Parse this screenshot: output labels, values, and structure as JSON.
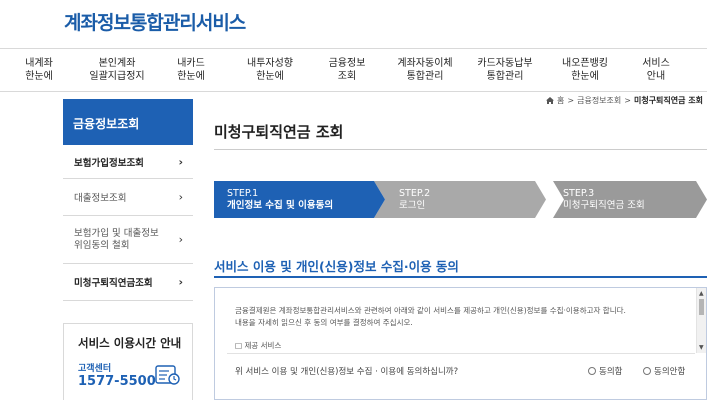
{
  "site_title": "계좌정보통합관리서비스",
  "gnb": [
    {
      "line1": "내계좌",
      "line2": "한눈에"
    },
    {
      "line1": "본인계좌",
      "line2": "일괄지급정지"
    },
    {
      "line1": "내카드",
      "line2": "한눈에"
    },
    {
      "line1": "내투자성향",
      "line2": "한눈에"
    },
    {
      "line1": "금융정보",
      "line2": "조회"
    },
    {
      "line1": "계좌자동이체",
      "line2": "통합관리"
    },
    {
      "line1": "카드자동납부",
      "line2": "통합관리"
    },
    {
      "line1": "내오픈뱅킹",
      "line2": "한눈에"
    },
    {
      "line1": "서비스",
      "line2": "안내"
    }
  ],
  "breadcrumb": {
    "home": "홈",
    "level1": "금융정보조회",
    "current": "미청구퇴직연금 조회"
  },
  "lnb": {
    "title": "금융정보조회",
    "items": [
      {
        "label": "보험가입정보조회"
      },
      {
        "label": "대출정보조회"
      },
      {
        "label_line1": "보험가입 및 대출정보",
        "label_line2": "위임동의 철회"
      },
      {
        "label": "미청구퇴직연금조회"
      }
    ]
  },
  "service_hours": {
    "title": "서비스 이용시간 안내",
    "center_label": "고객센터",
    "phone": "1577-5500"
  },
  "page_title": "미청구퇴직연금 조회",
  "steps": [
    {
      "num": "STEP.1",
      "label": "개인정보 수집 및 이용동의",
      "active": true
    },
    {
      "num": "STEP.2",
      "label": "로그인",
      "active": false
    },
    {
      "num": "STEP.3",
      "label": "미청구퇴직연금 조회",
      "active": false
    }
  ],
  "consent": {
    "section_title": "서비스 이용 및 개인(신용)정보 수집·이용 동의",
    "text_line1": "금융결제원은 계좌정보통합관리서비스와 관련하여 아래와 같이 서비스를 제공하고 개인(신용)정보를 수집·이용하고자 합니다.",
    "text_line2": "내용을 자세히 읽으신 후 동의 여부를 결정하여 주십시오.",
    "item1": "□ 제공 서비스",
    "question": "위 서비스 이용 및 개인(신용)정보 수집 · 이용에 동의하십니까?",
    "agree": "동의함",
    "disagree": "동의안함"
  },
  "colors": {
    "primary": "#1e61b4",
    "step_inactive": "#a9a9a9",
    "step_inactive_dark": "#9a9a9a"
  }
}
